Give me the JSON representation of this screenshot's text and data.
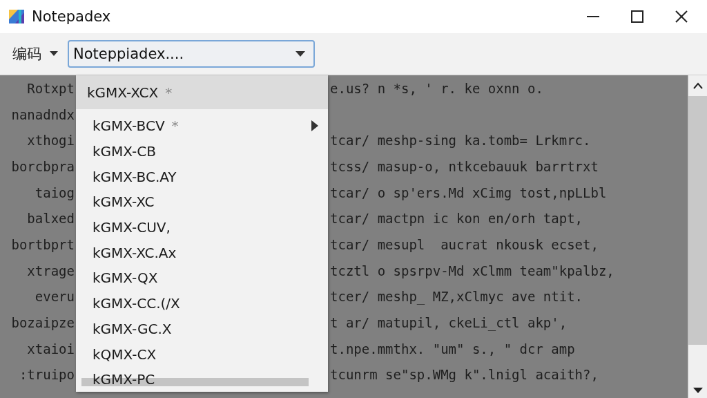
{
  "window": {
    "title": "Notepadex"
  },
  "toolbar": {
    "encoding_label": "编码",
    "combo": {
      "value": "Noteppiadex...."
    }
  },
  "editor": {
    "lines": [
      {
        "left": "Rotxpt",
        "right": "e.us? n *s, ' r. ke oxnn o."
      },
      {
        "left": "nanadndx"
      },
      {
        "left": "xthogi",
        "right": "tcar/ meshp-sing ka.tomb= Lrkmrc."
      },
      {
        "left": "borcbpra",
        "right": "tcss/ masup-o, ntkcebauuk barrtrxt"
      },
      {
        "left": "taiog",
        "right": "tcar/ o sp'ers.Md xCimg tost,npLLbl"
      },
      {
        "left": "balxed",
        "right": "tcar/ mactpn ic kon en/orh tapt,"
      },
      {
        "left": "bortbprt",
        "right": "tcar/ mesupl  aucrat nkousk ecset,"
      },
      {
        "left": "xtrage",
        "right": "tcztl o spsrpv-Md xClmm team\"kpalbz,"
      },
      {
        "left": "everu",
        "right": "tcer/ meshp_ MZ,xClmyc ave ntit."
      },
      {
        "left": "bozaipze",
        "right": "t ar/ matupil, ckeLi_ctl akp',"
      },
      {
        "left": "xtaioi",
        "right": "t.npe.mmthx. \"um\" s., \" dcr amp"
      },
      {
        "left": ":truipo",
        "right": "tcunrm se\"sp.WMg k\".lnigl acaith?,"
      }
    ]
  },
  "dropdown": {
    "items": [
      {
        "label": "kGMX-XCX",
        "suffix": "*",
        "selected": true,
        "submenu": false
      },
      {
        "label": "kGMX-BCV",
        "suffix": "*",
        "selected": false,
        "submenu": true
      },
      {
        "label": "kGMX-CB",
        "selected": false,
        "submenu": false
      },
      {
        "label": "kGMX-BC.AY",
        "selected": false,
        "submenu": false
      },
      {
        "label": "kGMX-XC",
        "selected": false,
        "submenu": false
      },
      {
        "label": "kGMX-CUV,",
        "selected": false,
        "submenu": false
      },
      {
        "label": "kGMX-XC.Ax",
        "selected": false,
        "submenu": false
      },
      {
        "label": "kGMX-QX",
        "selected": false,
        "submenu": false
      },
      {
        "label": "kGMX-CC.(/X",
        "selected": false,
        "submenu": false
      },
      {
        "label": "kGMX-GC.X",
        "selected": false,
        "submenu": false
      },
      {
        "label": "kQMX-CX",
        "selected": false,
        "submenu": false
      },
      {
        "label": "kGMX-PC",
        "selected": false,
        "submenu": false
      }
    ]
  }
}
